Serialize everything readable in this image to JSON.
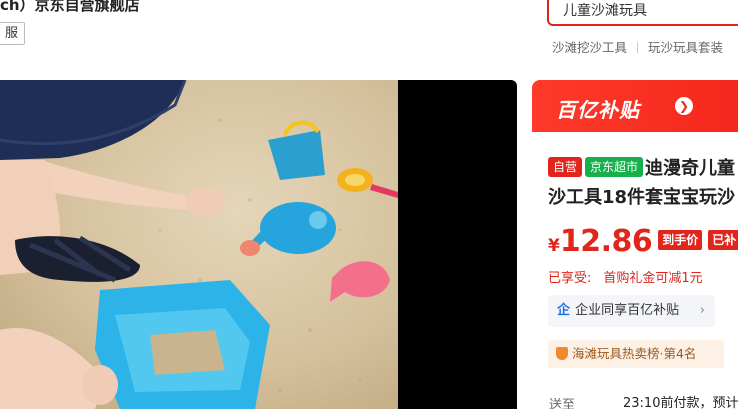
{
  "store": {
    "name": "ch）京东自营旗舰店",
    "tag": "服"
  },
  "search": {
    "value": "儿童沙滩玩具",
    "hot_words": [
      "沙滩挖沙工具",
      "玩沙玩具套装"
    ]
  },
  "banner": {
    "logo": "百亿补贴",
    "arrow": "❯"
  },
  "product": {
    "badge_self": "自营",
    "badge_market": "京东超市",
    "title_line1": "迪漫奇儿童",
    "title_line2": "沙工具18件套宝宝玩沙"
  },
  "price": {
    "currency": "¥",
    "value": "12.86",
    "tag1": "到手价",
    "tag2": "已补"
  },
  "enjoy": {
    "label": "已享受:",
    "value": "首购礼金可减1元"
  },
  "enterprise": {
    "label": "企业同享百亿补贴",
    "icon": "企"
  },
  "rank": {
    "text": "海滩玩具热卖榜·第4名"
  },
  "delivery": {
    "label": "送至",
    "text": "23:10前付款，预计"
  },
  "colors": {
    "brand_red": "#e1251b",
    "market_green": "#18b04c"
  }
}
